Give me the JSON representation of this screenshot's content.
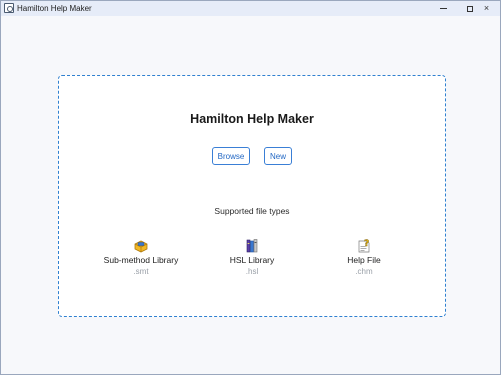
{
  "window": {
    "title": "Hamilton Help Maker",
    "minimize_glyph": "minimize-icon",
    "maximize_glyph": "maximize-icon",
    "close_glyph": "×"
  },
  "main": {
    "title": "Hamilton Help Maker",
    "browse_label": "Browse",
    "new_label": "New",
    "supported_label": "Supported file types",
    "accent_color": "#2f80d0"
  },
  "file_types": [
    {
      "name": "Sub-method Library",
      "ext": ".smt",
      "icon": "submethod-library-icon"
    },
    {
      "name": "HSL Library",
      "ext": ".hsl",
      "icon": "hsl-library-icon"
    },
    {
      "name": "Help File",
      "ext": ".chm",
      "icon": "help-file-icon"
    }
  ]
}
